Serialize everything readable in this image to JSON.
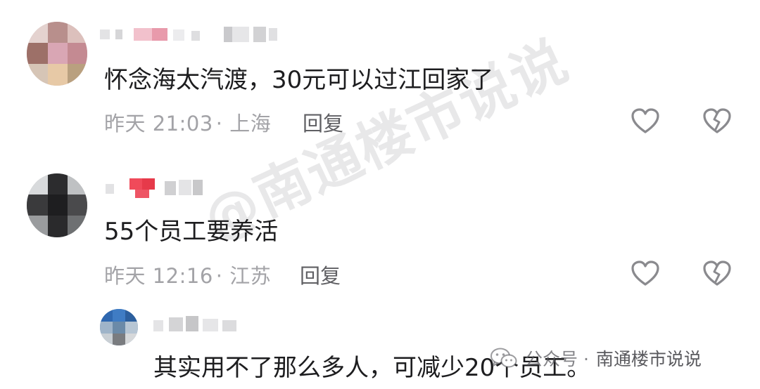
{
  "watermark": "@南通楼市说说",
  "wechat_mark": {
    "label": "公众号 ·",
    "name": "南通楼市说说"
  },
  "comments": [
    {
      "text": "怀念海太汽渡，30元可以过江回家了",
      "time": "昨天 21:03",
      "location": "· 上海",
      "reply_label": "回复",
      "like_icon": "heart-outline-icon",
      "dislike_icon": "broken-heart-icon"
    },
    {
      "text": "55个员工要养活",
      "time": "昨天 12:16",
      "location": "· 江苏",
      "reply_label": "回复",
      "like_icon": "heart-outline-icon",
      "dislike_icon": "broken-heart-icon"
    },
    {
      "text": "其实用不了那么多人，可减少20个员工。"
    }
  ],
  "colors": {
    "text": "#1d1d1f",
    "meta": "#a3a3a7",
    "reply": "#5f5f63",
    "icon": "#8a8a8e"
  }
}
